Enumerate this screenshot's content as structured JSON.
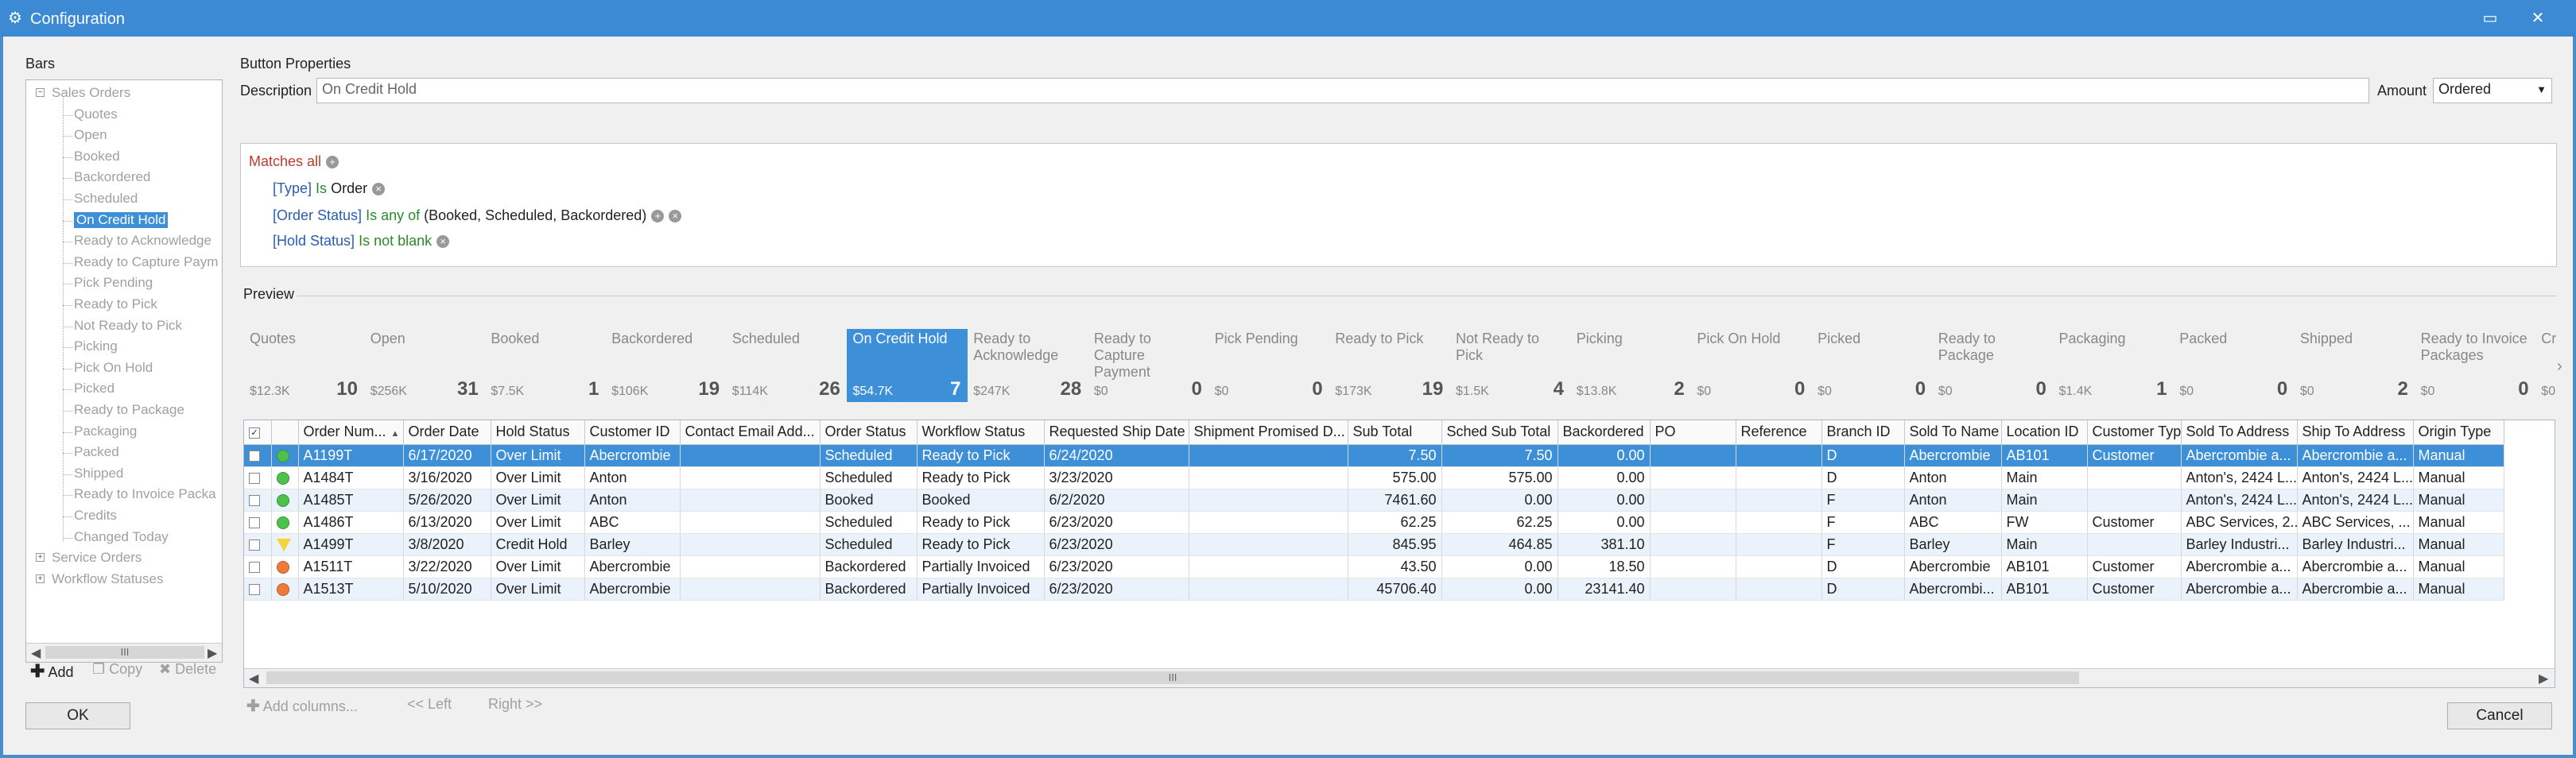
{
  "window": {
    "title": "Configuration",
    "minimize": "▭",
    "close": "✕"
  },
  "left": {
    "group_label": "Bars",
    "tree": [
      {
        "label": "Sales Orders",
        "level": 0,
        "expander": "−"
      },
      {
        "label": "Quotes",
        "level": 1
      },
      {
        "label": "Open",
        "level": 1
      },
      {
        "label": "Booked",
        "level": 1
      },
      {
        "label": "Backordered",
        "level": 1
      },
      {
        "label": "Scheduled",
        "level": 1
      },
      {
        "label": "On Credit Hold",
        "level": 1,
        "selected": true
      },
      {
        "label": "Ready to Acknowledge",
        "level": 1
      },
      {
        "label": "Ready to Capture Paym",
        "level": 1
      },
      {
        "label": "Pick Pending",
        "level": 1
      },
      {
        "label": "Ready to Pick",
        "level": 1
      },
      {
        "label": "Not Ready to Pick",
        "level": 1
      },
      {
        "label": "Picking",
        "level": 1
      },
      {
        "label": "Pick On Hold",
        "level": 1
      },
      {
        "label": "Picked",
        "level": 1
      },
      {
        "label": "Ready to Package",
        "level": 1
      },
      {
        "label": "Packaging",
        "level": 1
      },
      {
        "label": "Packed",
        "level": 1
      },
      {
        "label": "Shipped",
        "level": 1
      },
      {
        "label": "Ready to Invoice Packa",
        "level": 1
      },
      {
        "label": "Credits",
        "level": 1
      },
      {
        "label": "Changed Today",
        "level": 1
      },
      {
        "label": "Service Orders",
        "level": 0,
        "expander": "+"
      },
      {
        "label": "Workflow Statuses",
        "level": 0,
        "expander": "+"
      }
    ],
    "scroll_grip": "III",
    "add": "Add",
    "copy": "Copy",
    "delete": "Delete"
  },
  "props": {
    "group_label": "Button Properties",
    "description_label": "Description",
    "description_value": "On Credit Hold",
    "amount_label": "Amount",
    "amount_value": "Ordered",
    "matches": "Matches all",
    "cond1_field": "[Type]",
    "cond1_op": "Is",
    "cond1_val": "Order",
    "cond2_field": "[Order Status]",
    "cond2_op": "Is any of",
    "cond2_val": "(Booked, Scheduled, Backordered)",
    "cond3_field": "[Hold Status]",
    "cond3_op": "Is not blank"
  },
  "preview": {
    "label": "Preview",
    "bars": [
      {
        "name": "Quotes",
        "amount": "$12.3K",
        "count": "10"
      },
      {
        "name": "Open",
        "amount": "$256K",
        "count": "31"
      },
      {
        "name": "Booked",
        "amount": "$7.5K",
        "count": "1"
      },
      {
        "name": "Backordered",
        "amount": "$106K",
        "count": "19"
      },
      {
        "name": "Scheduled",
        "amount": "$114K",
        "count": "26"
      },
      {
        "name": "On Credit Hold",
        "amount": "$54.7K",
        "count": "7",
        "selected": true
      },
      {
        "name": "Ready to Acknowledge",
        "amount": "$247K",
        "count": "28"
      },
      {
        "name": "Ready to Capture Payment",
        "amount": "$0",
        "count": "0"
      },
      {
        "name": "Pick Pending",
        "amount": "$0",
        "count": "0"
      },
      {
        "name": "Ready to Pick",
        "amount": "$173K",
        "count": "19"
      },
      {
        "name": "Not Ready to Pick",
        "amount": "$1.5K",
        "count": "4"
      },
      {
        "name": "Picking",
        "amount": "$13.8K",
        "count": "2"
      },
      {
        "name": "Pick On Hold",
        "amount": "$0",
        "count": "0"
      },
      {
        "name": "Picked",
        "amount": "$0",
        "count": "0"
      },
      {
        "name": "Ready to Package",
        "amount": "$0",
        "count": "0"
      },
      {
        "name": "Packaging",
        "amount": "$1.4K",
        "count": "1"
      },
      {
        "name": "Packed",
        "amount": "$0",
        "count": "0"
      },
      {
        "name": "Shipped",
        "amount": "$0",
        "count": "2"
      },
      {
        "name": "Ready to Invoice Packages",
        "amount": "$0",
        "count": "0"
      },
      {
        "name": "Cr",
        "amount": "$0",
        "count": ""
      }
    ],
    "next_arrow": "›"
  },
  "grid": {
    "columns": [
      "",
      "",
      "Order Num...",
      "Order Date",
      "Hold Status",
      "Customer ID",
      "Contact Email Add...",
      "Order Status",
      "Workflow Status",
      "Requested Ship Date",
      "Shipment Promised D...",
      "Sub Total",
      "Sched Sub Total",
      "Backordered",
      "PO",
      "Reference",
      "Branch ID",
      "Sold To Name",
      "Location ID",
      "Customer Type",
      "Sold To Address",
      "Ship To Address",
      "Origin Type"
    ],
    "rows": [
      {
        "status": "green",
        "cells": [
          "A1199T",
          "6/17/2020",
          "Over Limit",
          "Abercrombie",
          "",
          "Scheduled",
          "Ready to Pick",
          "6/24/2020",
          "",
          "7.50",
          "7.50",
          "0.00",
          "",
          "",
          "D",
          "Abercrombie",
          "AB101",
          "Customer",
          "Abercrombie a...",
          "Abercrombie a...",
          "Manual"
        ]
      },
      {
        "status": "green",
        "cells": [
          "A1484T",
          "3/16/2020",
          "Over Limit",
          "Anton",
          "",
          "Scheduled",
          "Ready to Pick",
          "3/23/2020",
          "",
          "575.00",
          "575.00",
          "0.00",
          "",
          "",
          "D",
          "Anton",
          "Main",
          "",
          "Anton's, 2424 L...",
          "Anton's, 2424 L...",
          "Manual"
        ]
      },
      {
        "status": "green",
        "cells": [
          "A1485T",
          "5/26/2020",
          "Over Limit",
          "Anton",
          "",
          "Booked",
          "Booked",
          "6/2/2020",
          "",
          "7461.60",
          "0.00",
          "0.00",
          "",
          "",
          "F",
          "Anton",
          "Main",
          "",
          "Anton's, 2424 L...",
          "Anton's, 2424 L...",
          "Manual"
        ]
      },
      {
        "status": "green",
        "cells": [
          "A1486T",
          "6/13/2020",
          "Over Limit",
          "ABC",
          "",
          "Scheduled",
          "Ready to Pick",
          "6/23/2020",
          "",
          "62.25",
          "62.25",
          "0.00",
          "",
          "",
          "F",
          "ABC",
          "FW",
          "Customer",
          "ABC Services, 2...",
          "ABC Services, ...",
          "Manual"
        ]
      },
      {
        "status": "yellow",
        "cells": [
          "A1499T",
          "3/8/2020",
          "Credit Hold",
          "Barley",
          "",
          "Scheduled",
          "Ready to Pick",
          "6/23/2020",
          "",
          "845.95",
          "464.85",
          "381.10",
          "",
          "",
          "F",
          "Barley",
          "Main",
          "",
          "Barley Industri...",
          "Barley Industri...",
          "Manual"
        ]
      },
      {
        "status": "orange",
        "cells": [
          "A1511T",
          "3/22/2020",
          "Over Limit",
          "Abercrombie",
          "",
          "Backordered",
          "Partially Invoiced",
          "6/23/2020",
          "",
          "43.50",
          "0.00",
          "18.50",
          "",
          "",
          "D",
          "Abercrombie",
          "AB101",
          "Customer",
          "Abercrombie a...",
          "Abercrombie a...",
          "Manual"
        ]
      },
      {
        "status": "orange",
        "cells": [
          "A1513T",
          "5/10/2020",
          "Over Limit",
          "Abercrombie",
          "",
          "Backordered",
          "Partially Invoiced",
          "6/23/2020",
          "",
          "45706.40",
          "0.00",
          "23141.40",
          "",
          "",
          "D",
          "Abercrombi...",
          "AB101",
          "Customer",
          "Abercrombie a...",
          "Abercrombie a...",
          "Manual"
        ]
      }
    ],
    "scroll_grip": "III"
  },
  "toolbar": {
    "add_columns": "Add columns...",
    "left": "<< Left",
    "right": "Right >>"
  },
  "footer": {
    "ok": "OK",
    "cancel": "Cancel"
  },
  "colors": {
    "accent": "#3d8fd8",
    "green": "#4cc24c",
    "yellow": "#f5d33a",
    "orange": "#f07a3a"
  }
}
